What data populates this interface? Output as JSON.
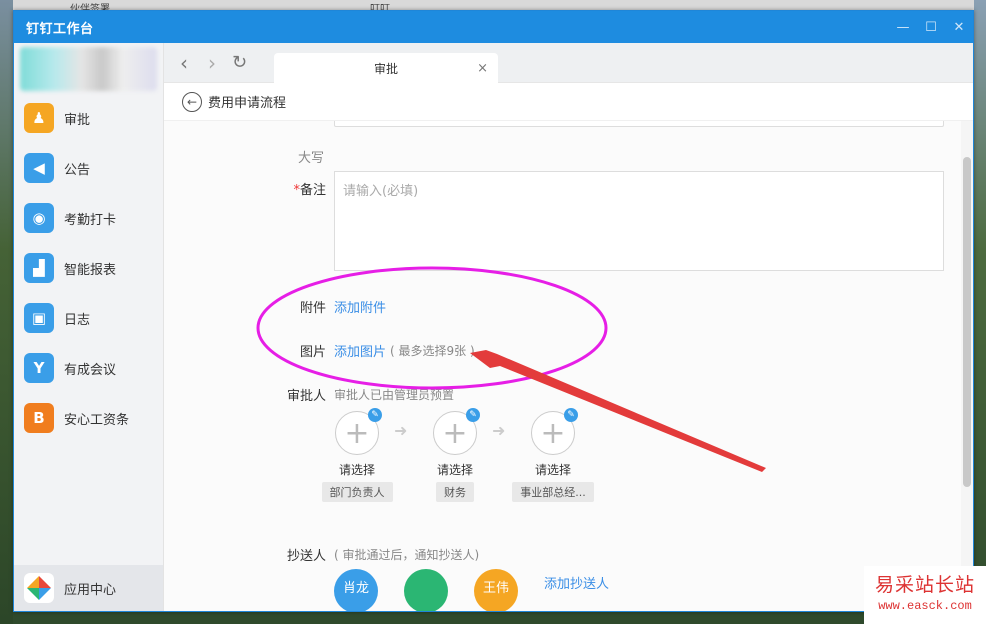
{
  "desktop": {
    "taskbar_item_1": "伙伴签署",
    "taskbar_item_2": "叮叮"
  },
  "window": {
    "title": "钉钉工作台",
    "min_glyph": "—",
    "max_glyph": "☐",
    "close_glyph": "✕"
  },
  "sidebar": {
    "items": [
      {
        "label": "审批",
        "icon": "approval-icon",
        "color": "#f5a623",
        "glyph": "♟"
      },
      {
        "label": "公告",
        "icon": "megaphone-icon",
        "color": "#3a9ee8",
        "glyph": "◀"
      },
      {
        "label": "考勤打卡",
        "icon": "location-pin-icon",
        "color": "#3a9ee8",
        "glyph": "◉"
      },
      {
        "label": "智能报表",
        "icon": "bar-chart-icon",
        "color": "#3a9ee8",
        "glyph": "▟"
      },
      {
        "label": "日志",
        "icon": "notebook-icon",
        "color": "#3a9ee8",
        "glyph": "▣"
      },
      {
        "label": "有成会议",
        "icon": "meeting-icon",
        "color": "#3a9ee8",
        "glyph": "Y"
      },
      {
        "label": "安心工资条",
        "icon": "payslip-icon",
        "color": "#f07d1e",
        "glyph": "B"
      }
    ],
    "bottom": {
      "label": "应用中心",
      "icon": "app-center-icon"
    }
  },
  "browser": {
    "back": "‹",
    "forward": "›",
    "reload": "↻",
    "tab_label": "审批",
    "tab_close": "×"
  },
  "page": {
    "back_title": "费用申请流程"
  },
  "form": {
    "daxie_label": "大写",
    "remark_required": "*",
    "remark_label": "备注",
    "remark_placeholder": "请输入(必填)",
    "attachment_label": "附件",
    "attachment_link": "添加附件",
    "image_label": "图片",
    "image_link": "添加图片",
    "image_hint": "( 最多选择9张 )",
    "approver_label": "审批人",
    "approver_hint": "审批人已由管理员预置",
    "approvers": [
      {
        "name": "请选择",
        "role": "部门负责人"
      },
      {
        "name": "请选择",
        "role": "财务"
      },
      {
        "name": "请选择",
        "role": "事业部总经..."
      }
    ],
    "cc_label": "抄送人",
    "cc_hint": "( 审批通过后，通知抄送人)",
    "cc_link": "添加抄送人",
    "cc_avatars": [
      {
        "text": "肖龙",
        "color": "#3a9ee8"
      },
      {
        "text": "",
        "color": "#2bb673"
      },
      {
        "text": "王伟",
        "color": "#f5a623"
      }
    ]
  },
  "watermark": {
    "brand": "易采站长站",
    "url": "www.easck.com"
  },
  "colors": {
    "titlebar": "#1e8ce0",
    "link": "#3a8ee6",
    "annotation": "#e61ee6",
    "arrow": "#e33b3b"
  }
}
